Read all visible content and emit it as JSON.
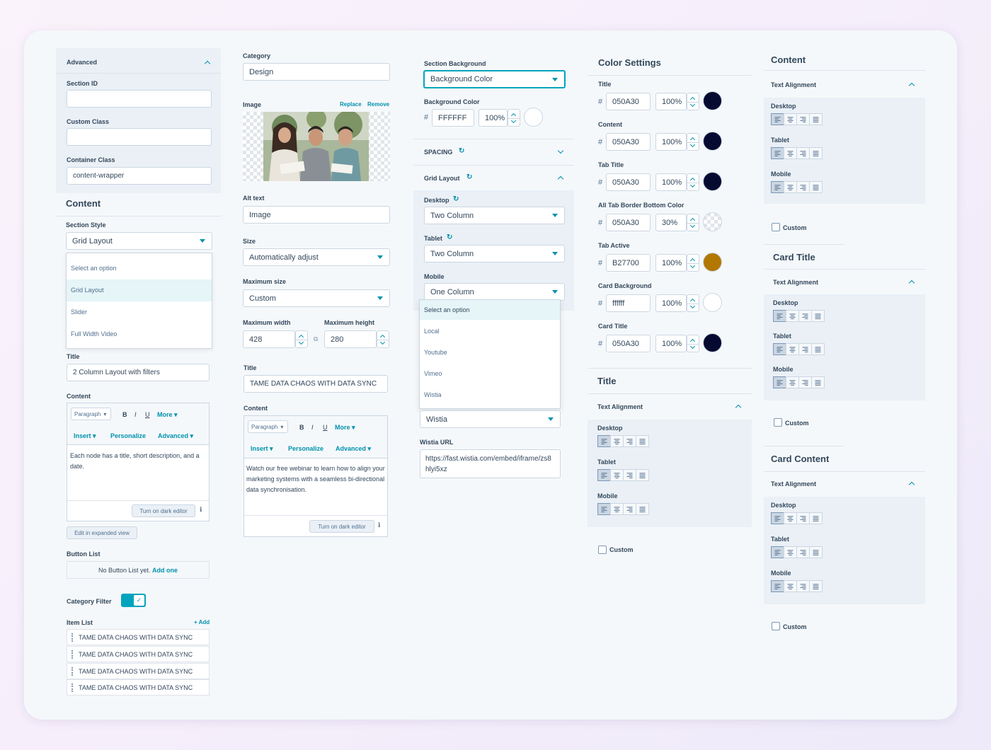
{
  "col1": {
    "advanced": {
      "title": "Advanced",
      "section_id": "Section ID",
      "custom_class": "Custom Class",
      "container_class": "Container Class",
      "container_value": "content-wrapper"
    },
    "content_heading": "Content",
    "section_style": {
      "label": "Section Style",
      "value": "Grid Layout",
      "options": [
        "Select an option",
        "Grid Layout",
        "Slider",
        "Full Width Video"
      ]
    },
    "title": {
      "label": "Title",
      "value": "2 Column Layout with filters"
    },
    "content": {
      "label": "Content",
      "paragraph": "Paragraph",
      "bold": "B",
      "italic": "I",
      "underline": "U",
      "more": "More",
      "insert": "Insert",
      "personalize": "Personalize",
      "advanced": "Advanced",
      "text": "Each node has a title, short description, and a date.",
      "dark_editor": "Turn on dark editor",
      "expanded": "Edit in expanded view"
    },
    "button_list": {
      "label": "Button List",
      "empty": "No Button List yet.",
      "add_one": "Add one"
    },
    "category_filter": {
      "label": "Category Filter",
      "enabled": true
    },
    "item_list": {
      "label": "Item List",
      "add": "+ Add",
      "items": [
        "TAME DATA CHAOS WITH DATA SYNC",
        "TAME DATA CHAOS WITH DATA SYNC",
        "TAME DATA CHAOS WITH DATA SYNC",
        "TAME DATA CHAOS WITH DATA SYNC"
      ]
    }
  },
  "col2": {
    "category": {
      "label": "Category",
      "value": "Design"
    },
    "image": {
      "label": "Image",
      "replace": "Replace",
      "remove": "Remove"
    },
    "alt_text": {
      "label": "Alt text",
      "value": "Image"
    },
    "size": {
      "label": "Size",
      "value": "Automatically adjust"
    },
    "max_size": {
      "label": "Maximum size",
      "value": "Custom"
    },
    "max_width": {
      "label": "Maximum width",
      "value": "428"
    },
    "max_height": {
      "label": "Maximum height",
      "value": "280"
    },
    "title": {
      "label": "Title",
      "value": "TAME DATA CHAOS WITH DATA SYNC"
    },
    "content": {
      "label": "Content",
      "paragraph": "Paragraph",
      "bold": "B",
      "italic": "I",
      "underline": "U",
      "more": "More",
      "insert": "Insert",
      "personalize": "Personalize",
      "advanced": "Advanced",
      "text": "Watch our free webinar to learn how to align your marketing systems with a seamless bi-directional data synchronisation.",
      "dark_editor": "Turn on dark editor"
    }
  },
  "col3": {
    "section_background": {
      "label": "Section Background",
      "value": "Background Color"
    },
    "background_color": {
      "label": "Background Color",
      "hash": "#",
      "hex": "FFFFFF",
      "opacity": "100%",
      "color": "#FFFFFF"
    },
    "spacing": "SPACING",
    "grid_layout": {
      "title": "Grid Layout",
      "desktop_label": "Desktop",
      "desktop": "Two Column",
      "tablet_label": "Tablet",
      "tablet": "Two Column",
      "mobile_label": "Mobile",
      "mobile": "One Column"
    },
    "video_options": [
      "Select an option",
      "Local",
      "Youtube",
      "Vimeo",
      "Wistia"
    ],
    "video_value": "Wistia",
    "wistia_url": {
      "label": "Wistia URL",
      "value": "https://fast.wistia.com/embed/iframe/zs8hlyi5xz"
    }
  },
  "col4": {
    "color_settings": "Color Settings",
    "colors": [
      {
        "label": "Title",
        "hex": "050A30",
        "opacity": "100%",
        "color": "#050A30"
      },
      {
        "label": "Content",
        "hex": "050A30",
        "opacity": "100%",
        "color": "#050A30"
      },
      {
        "label": "Tab Title",
        "hex": "050A30",
        "opacity": "100%",
        "color": "#050A30"
      },
      {
        "label": "All Tab Border Bottom Color",
        "hex": "050A30",
        "opacity": "30%",
        "color": "#050A30"
      },
      {
        "label": "Tab Active",
        "hex": "B27700",
        "opacity": "100%",
        "color": "#B27700"
      },
      {
        "label": "Card Background",
        "hex": "ffffff",
        "opacity": "100%",
        "color": "#ffffff"
      },
      {
        "label": "Card Title",
        "hex": "050A30",
        "opacity": "100%",
        "color": "#050A30"
      }
    ],
    "hash": "#",
    "title_section": {
      "heading": "Title",
      "text_alignment": "Text Alignment",
      "desktop": "Desktop",
      "tablet": "Tablet",
      "mobile": "Mobile",
      "custom": "Custom"
    }
  },
  "col5": {
    "content_section": {
      "heading": "Content",
      "text_alignment": "Text Alignment",
      "desktop": "Desktop",
      "tablet": "Tablet",
      "mobile": "Mobile",
      "custom": "Custom"
    },
    "card_title_section": {
      "heading": "Card Title",
      "text_alignment": "Text Alignment",
      "desktop": "Desktop",
      "tablet": "Tablet",
      "mobile": "Mobile",
      "custom": "Custom"
    },
    "card_content_section": {
      "heading": "Card Content",
      "text_alignment": "Text Alignment",
      "desktop": "Desktop",
      "tablet": "Tablet",
      "mobile": "Mobile",
      "custom": "Custom"
    }
  },
  "colors": {
    "accent": "#0091ae",
    "accent_bright": "#00a4bd",
    "panel": "#eaf0f6",
    "text": "#33475b"
  }
}
